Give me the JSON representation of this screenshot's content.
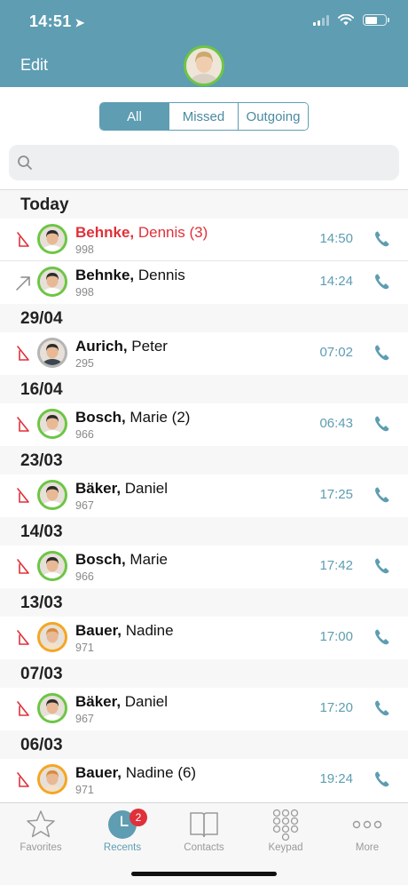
{
  "status_bar": {
    "time": "14:51"
  },
  "header": {
    "edit_label": "Edit"
  },
  "filter": {
    "tabs": [
      "All",
      "Missed",
      "Outgoing"
    ],
    "active": "All"
  },
  "search": {
    "placeholder": ""
  },
  "sections": [
    {
      "date": "Today",
      "calls": [
        {
          "last": "Behnke,",
          "first": "Dennis (3)",
          "ext": "998",
          "time": "14:50",
          "direction": "missed",
          "avatar": "green"
        },
        {
          "last": "Behnke,",
          "first": "Dennis",
          "ext": "998",
          "time": "14:24",
          "direction": "outgoing",
          "avatar": "green"
        }
      ]
    },
    {
      "date": "29/04",
      "calls": [
        {
          "last": "Aurich,",
          "first": "Peter",
          "ext": "295",
          "time": "07:02",
          "direction": "incoming-missed",
          "avatar": "grey"
        }
      ]
    },
    {
      "date": "16/04",
      "calls": [
        {
          "last": "Bosch,",
          "first": "Marie (2)",
          "ext": "966",
          "time": "06:43",
          "direction": "incoming-missed",
          "avatar": "green"
        }
      ]
    },
    {
      "date": "23/03",
      "calls": [
        {
          "last": "Bäker,",
          "first": "Daniel",
          "ext": "967",
          "time": "17:25",
          "direction": "incoming-missed",
          "avatar": "green"
        }
      ]
    },
    {
      "date": "14/03",
      "calls": [
        {
          "last": "Bosch,",
          "first": "Marie",
          "ext": "966",
          "time": "17:42",
          "direction": "incoming-missed",
          "avatar": "green"
        }
      ]
    },
    {
      "date": "13/03",
      "calls": [
        {
          "last": "Bauer,",
          "first": "Nadine",
          "ext": "971",
          "time": "17:00",
          "direction": "incoming-missed",
          "avatar": "orange"
        }
      ]
    },
    {
      "date": "07/03",
      "calls": [
        {
          "last": "Bäker,",
          "first": "Daniel",
          "ext": "967",
          "time": "17:20",
          "direction": "incoming-missed",
          "avatar": "green"
        }
      ]
    },
    {
      "date": "06/03",
      "calls": [
        {
          "last": "Bauer,",
          "first": "Nadine (6)",
          "ext": "971",
          "time": "19:24",
          "direction": "incoming-missed",
          "avatar": "orange"
        }
      ]
    }
  ],
  "tabbar": {
    "favorites": "Favorites",
    "recents": "Recents",
    "recents_badge": "2",
    "contacts": "Contacts",
    "keypad": "Keypad",
    "more": "More"
  },
  "colors": {
    "accent": "#5e9db2",
    "missed": "#e0303a",
    "presence_green": "#6cc644"
  }
}
